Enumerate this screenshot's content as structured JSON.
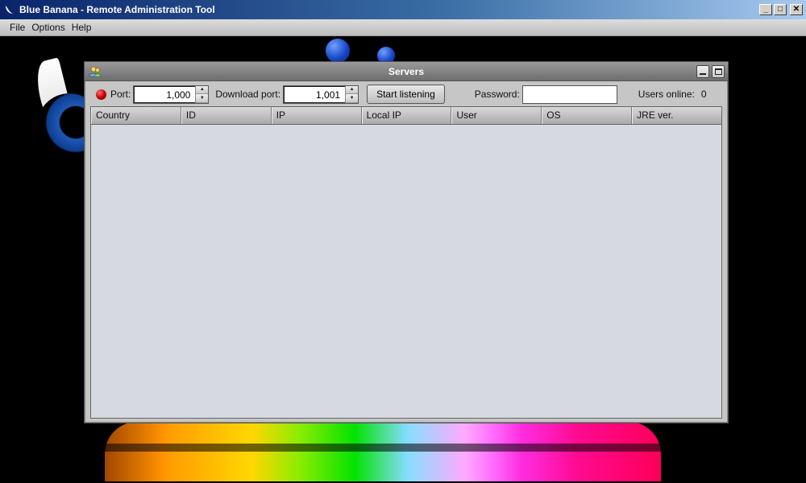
{
  "window": {
    "title": "Blue Banana - Remote Administration Tool",
    "controls": {
      "minimize": "_",
      "maximize": "□",
      "close": "✕"
    }
  },
  "menu": {
    "items": [
      "File",
      "Options",
      "Help"
    ]
  },
  "servers_frame": {
    "title": "Servers",
    "status_color": "#c00000",
    "port_label": "Port:",
    "port_value": "1,000",
    "download_port_label": "Download port:",
    "download_port_value": "1,001",
    "start_button": "Start listening",
    "password_label": "Password:",
    "password_value": "",
    "users_online_label": "Users online:",
    "users_online_count": "0",
    "table": {
      "columns": [
        "Country",
        "ID",
        "IP",
        "Local IP",
        "User",
        "OS",
        "JRE ver."
      ],
      "rows": []
    }
  }
}
